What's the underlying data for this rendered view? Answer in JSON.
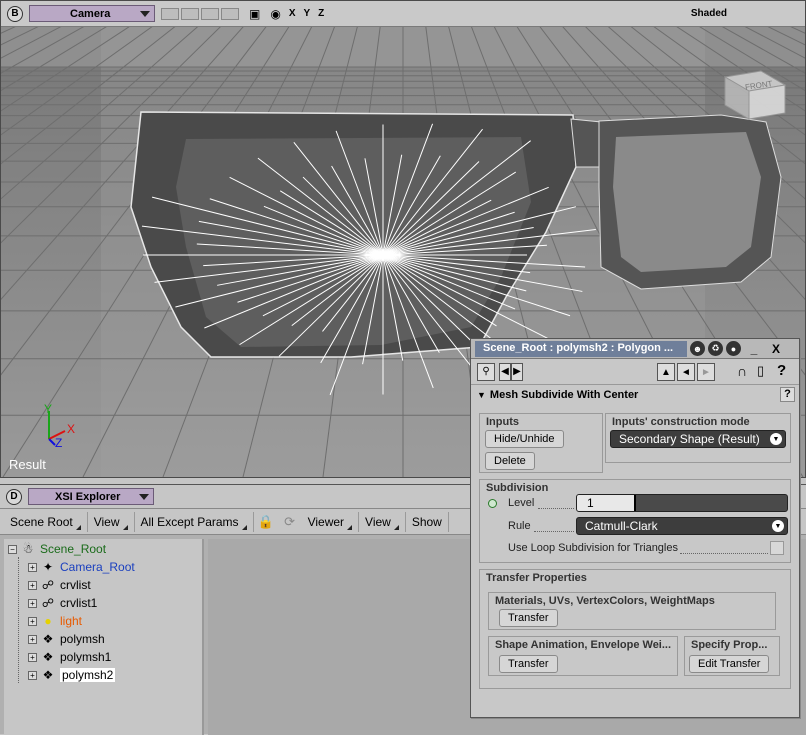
{
  "viewport": {
    "letter": "B",
    "camera_menu": "Camera",
    "axes": [
      "X",
      "Y",
      "Z"
    ],
    "shading": "Shaded",
    "result_label": "Result",
    "viewcube_label": "FRONT"
  },
  "explorer": {
    "letter": "D",
    "title": "XSI Explorer",
    "toolbar": [
      "Scene Root",
      "View",
      "All Except Params",
      "Viewer",
      "View",
      "Show"
    ],
    "tree": [
      {
        "label": "Scene_Root",
        "color": "#1a6b1a",
        "icon": "scene-root-icon"
      },
      {
        "label": "Camera_Root",
        "color": "#1a3fbf",
        "icon": "camera-root-icon"
      },
      {
        "label": "crvlist",
        "color": "#000000",
        "icon": "curve-icon"
      },
      {
        "label": "crvlist1",
        "color": "#000000",
        "icon": "curve-icon"
      },
      {
        "label": "light",
        "color": "#e85a00",
        "icon": "light-icon"
      },
      {
        "label": "polymsh",
        "color": "#000000",
        "icon": "polymesh-icon"
      },
      {
        "label": "polymsh1",
        "color": "#000000",
        "icon": "polymesh-icon"
      },
      {
        "label": "polymsh2",
        "color": "#000000",
        "icon": "polymesh-icon",
        "selected": true
      }
    ]
  },
  "ppg": {
    "title": "Scene_Root : polymsh2 : Polygon ...",
    "minimize": "_",
    "close": "X",
    "help": "?",
    "operator_title": "Mesh Subdivide With Center",
    "inputs": {
      "group_title": "Inputs",
      "hide_button": "Hide/Unhide",
      "delete_button": "Delete"
    },
    "construction": {
      "group_title": "Inputs' construction mode",
      "value": "Secondary Shape (Result)"
    },
    "subdivision": {
      "group_title": "Subdivision",
      "level_label": "Level",
      "level_value": "1",
      "rule_label": "Rule",
      "rule_value": "Catmull-Clark",
      "loop_label": "Use Loop Subdivision for Triangles"
    },
    "transfer": {
      "group_title": "Transfer Properties",
      "materials_title": "Materials, UVs, VertexColors, WeightMaps",
      "materials_button": "Transfer",
      "shape_title": "Shape Animation, Envelope Wei...",
      "shape_button": "Transfer",
      "specify_title": "Specify Prop...",
      "specify_button": "Edit Transfer"
    }
  }
}
